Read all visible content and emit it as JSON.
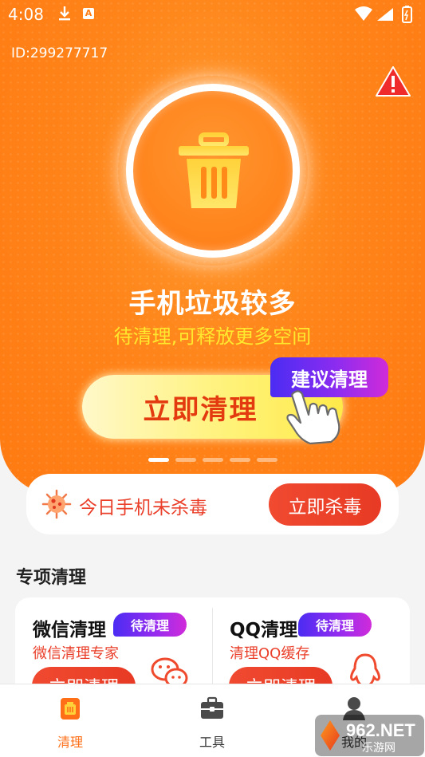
{
  "status_bar": {
    "time": "4:08",
    "a_badge": "A"
  },
  "header": {
    "user_id": "ID:299277717"
  },
  "hero": {
    "headline": "手机垃圾较多",
    "subline": "待清理,可释放更多空间",
    "clean_button": "立即清理",
    "suggest_badge": "建议清理",
    "carousel_total": 5,
    "carousel_active": 1
  },
  "virus_bar": {
    "text": "今日手机未杀毒",
    "button": "立即杀毒"
  },
  "special": {
    "title": "专项清理",
    "cards": [
      {
        "title": "微信清理",
        "badge": "待清理",
        "subtitle": "微信清理专家",
        "button": "立即清理",
        "icon": "wechat-icon"
      },
      {
        "title": "QQ清理",
        "badge": "待清理",
        "subtitle": "清理QQ缓存",
        "button": "立即清理",
        "icon": "qq-icon"
      }
    ]
  },
  "tabbar": {
    "items": [
      {
        "label": "清理",
        "icon": "clean-icon",
        "active": true
      },
      {
        "label": "工具",
        "icon": "toolbox-icon",
        "active": false
      },
      {
        "label": "我的",
        "icon": "profile-icon",
        "active": false
      }
    ]
  },
  "watermark": {
    "brand": "962.NET",
    "subtitle": "乐游网"
  },
  "colors": {
    "primary": "#ff7f17",
    "accent_red": "#e83a24",
    "highlight_yellow": "#ffe82e",
    "badge_purple": "#6a2cf0"
  }
}
